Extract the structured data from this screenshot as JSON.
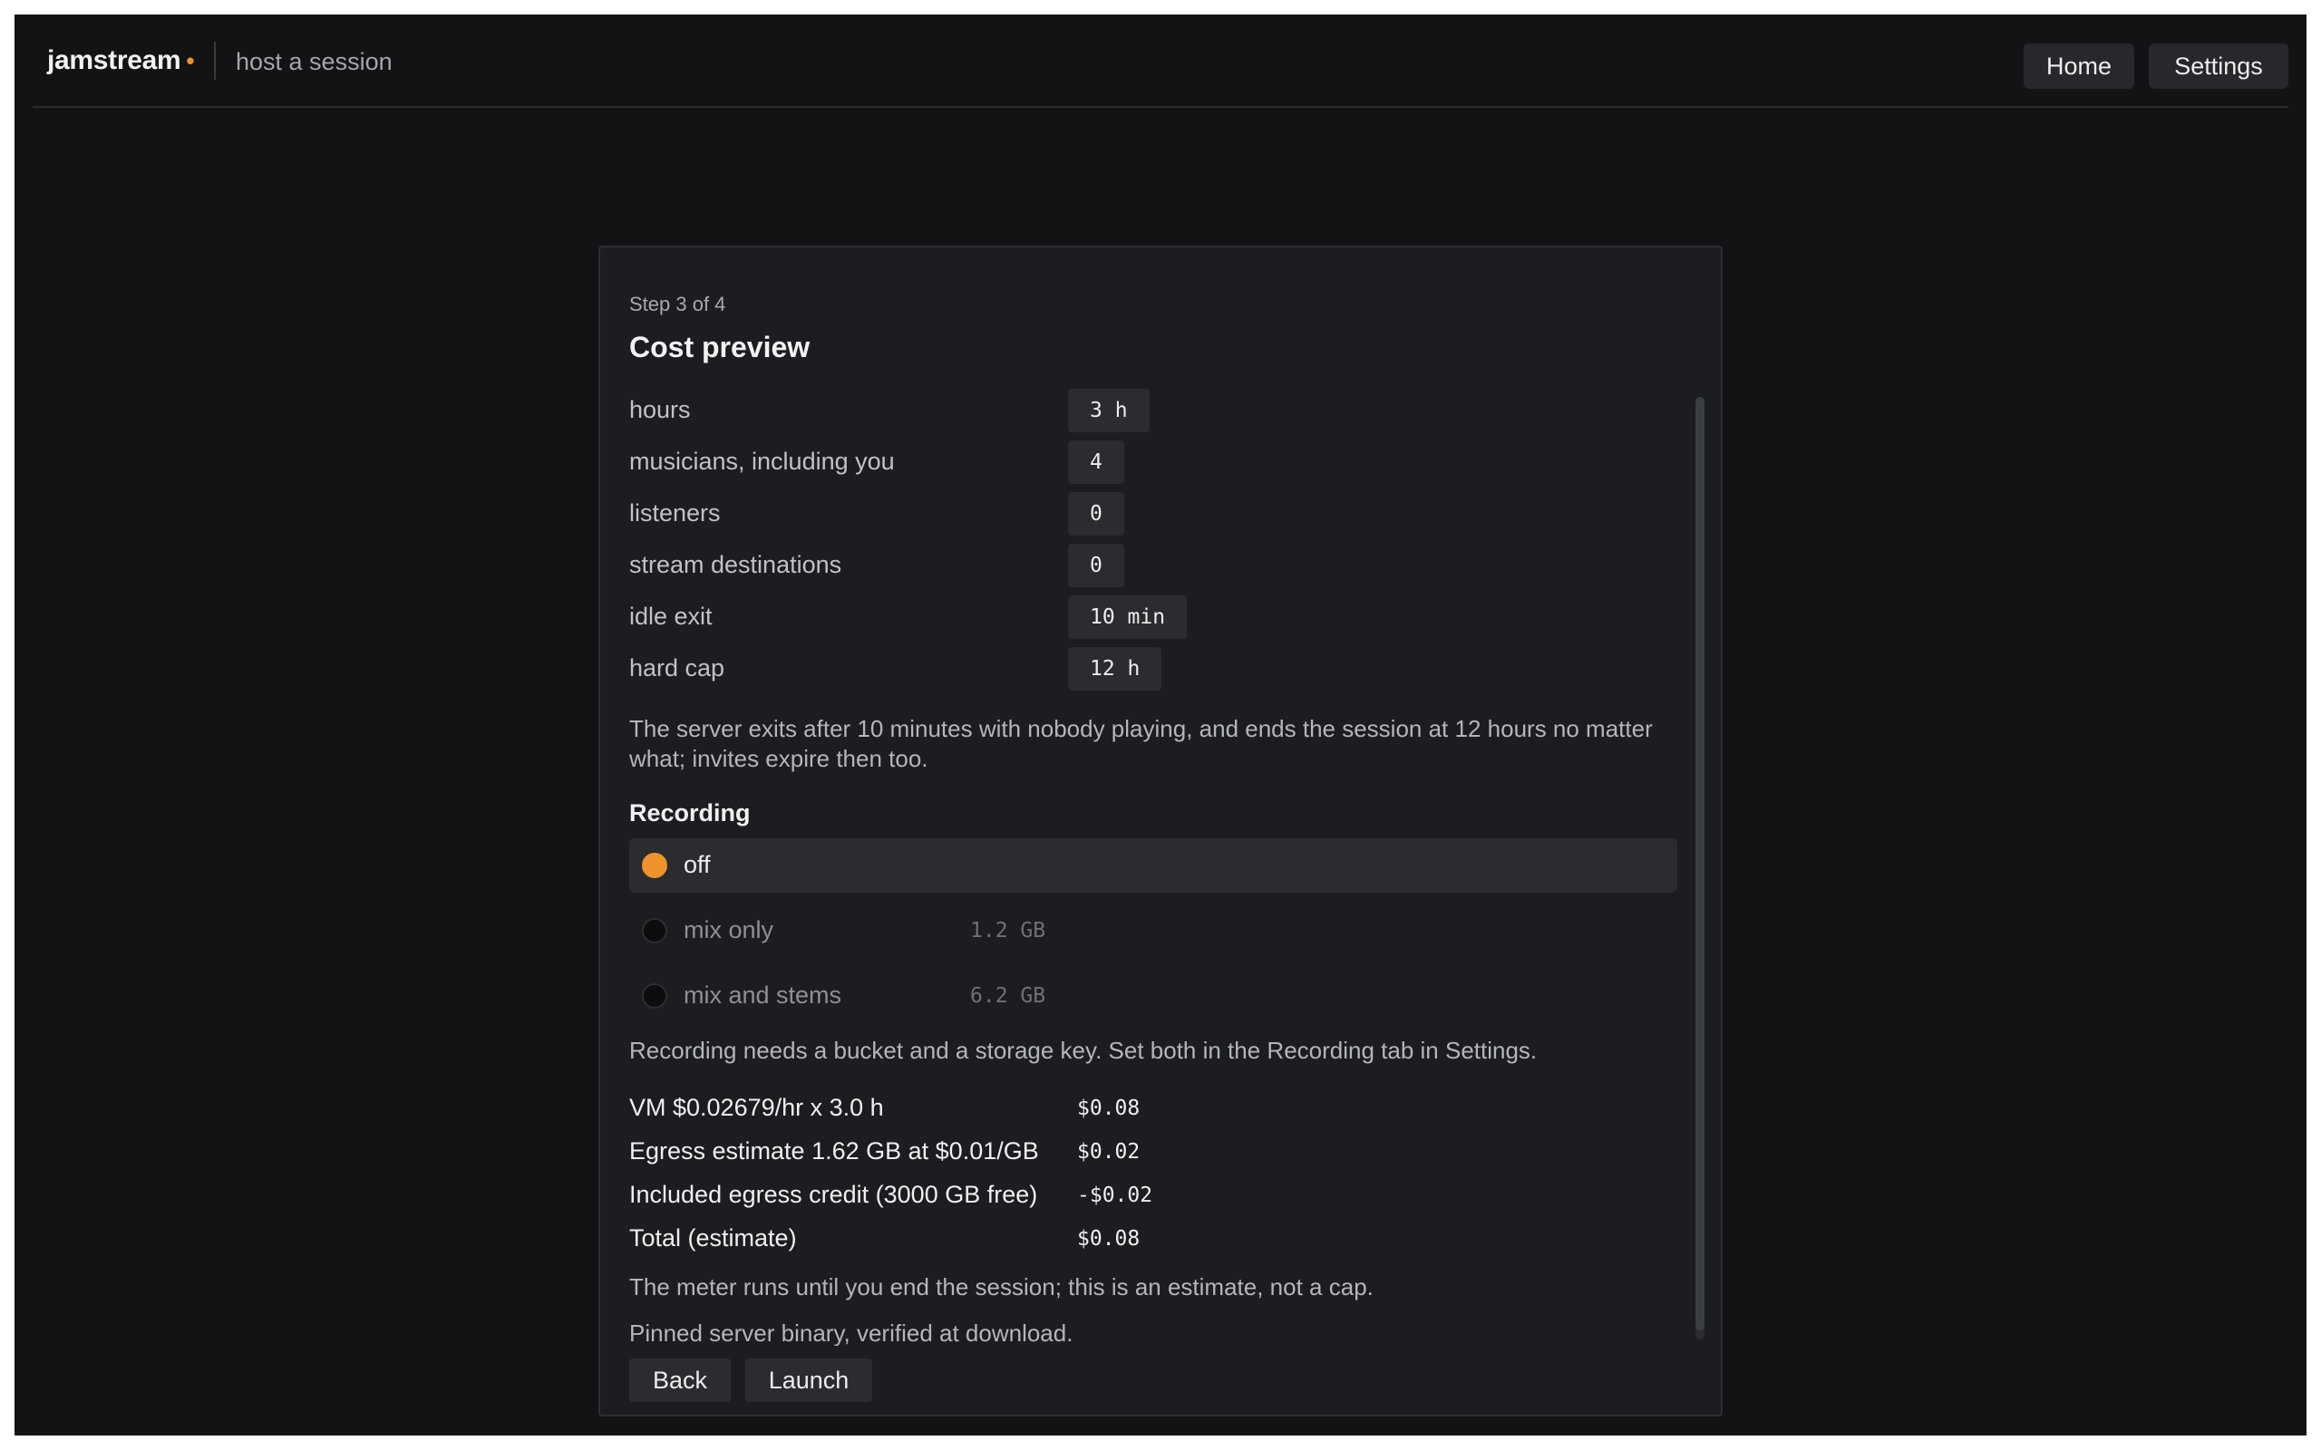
{
  "header": {
    "brand": "jamstream",
    "brand_dot": "•",
    "subtitle": "host a session",
    "nav": {
      "home": "Home",
      "settings": "Settings"
    }
  },
  "wizard": {
    "step": "Step 3 of 4",
    "title": "Cost preview",
    "fields": [
      {
        "label": "hours",
        "value": "3 h"
      },
      {
        "label": "musicians, including you",
        "value": "4"
      },
      {
        "label": "listeners",
        "value": "0"
      },
      {
        "label": "stream destinations",
        "value": "0"
      },
      {
        "label": "idle exit",
        "value": "10 min"
      },
      {
        "label": "hard cap",
        "value": "12 h"
      }
    ],
    "exit_note": "The server exits after 10 minutes with nobody playing, and ends the session at 12 hours no matter what; invites expire then too.",
    "recording": {
      "title": "Recording",
      "options": [
        {
          "label": "off",
          "size": "",
          "selected": true
        },
        {
          "label": "mix only",
          "size": "1.2 GB",
          "selected": false
        },
        {
          "label": "mix and stems",
          "size": "6.2 GB",
          "selected": false
        }
      ],
      "note": "Recording needs a bucket and a storage key. Set both in the Recording tab in Settings."
    },
    "costs": [
      {
        "label": "VM $0.02679/hr x 3.0 h",
        "value": "$0.08"
      },
      {
        "label": "Egress estimate 1.62 GB at $0.01/GB",
        "value": "$0.02"
      },
      {
        "label": "Included egress credit (3000 GB free)",
        "value": "-$0.02"
      },
      {
        "label": "Total (estimate)",
        "value": "$0.08"
      }
    ],
    "meter_note": "The meter runs until you end the session; this is an estimate, not a cap.",
    "binary_note": "Pinned server binary, verified at download.",
    "actions": {
      "back": "Back",
      "launch": "Launch"
    }
  },
  "colors": {
    "accent": "#f0922b",
    "background": "#121315",
    "card": "#1c1d20"
  }
}
